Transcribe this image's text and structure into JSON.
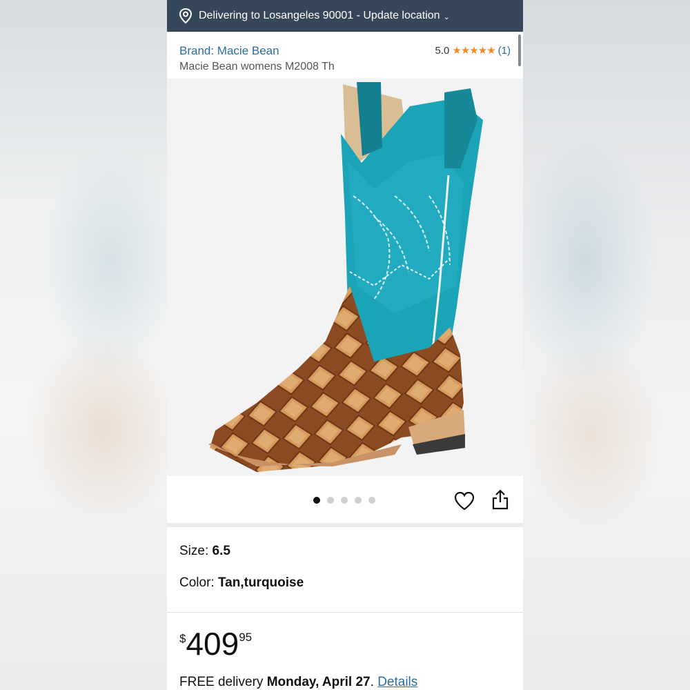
{
  "delivery_bar": {
    "text": "Delivering to Losangeles 90001 - Update location",
    "icon": "location-pin-icon",
    "chevron": "chevron-down-icon"
  },
  "product": {
    "brand": "Brand: Macie Bean",
    "title": "Macie Bean womens M2008 Th",
    "rating_value": "5.0",
    "stars": "★★★★★",
    "rating_count": "(1)",
    "image": "turquoise-and-tan-cowboy-boot"
  },
  "carousel": {
    "total_images": 5,
    "active_index": 0,
    "wishlist_icon": "heart-icon",
    "share_icon": "share-icon"
  },
  "variations": {
    "size_label": "Size: ",
    "size_value": "6.5",
    "color_label": "Color: ",
    "color_value": "Tan,turquoise"
  },
  "price": {
    "symbol": "$",
    "whole": "409",
    "fraction": "95"
  },
  "delivery": {
    "prefix": "FREE delivery ",
    "date": "Monday, April 27",
    "suffix": ". ",
    "details_link": "Details"
  },
  "colors": {
    "header_bg": "#37475a",
    "link": "#2b6d9e",
    "star": "#f08a24"
  }
}
